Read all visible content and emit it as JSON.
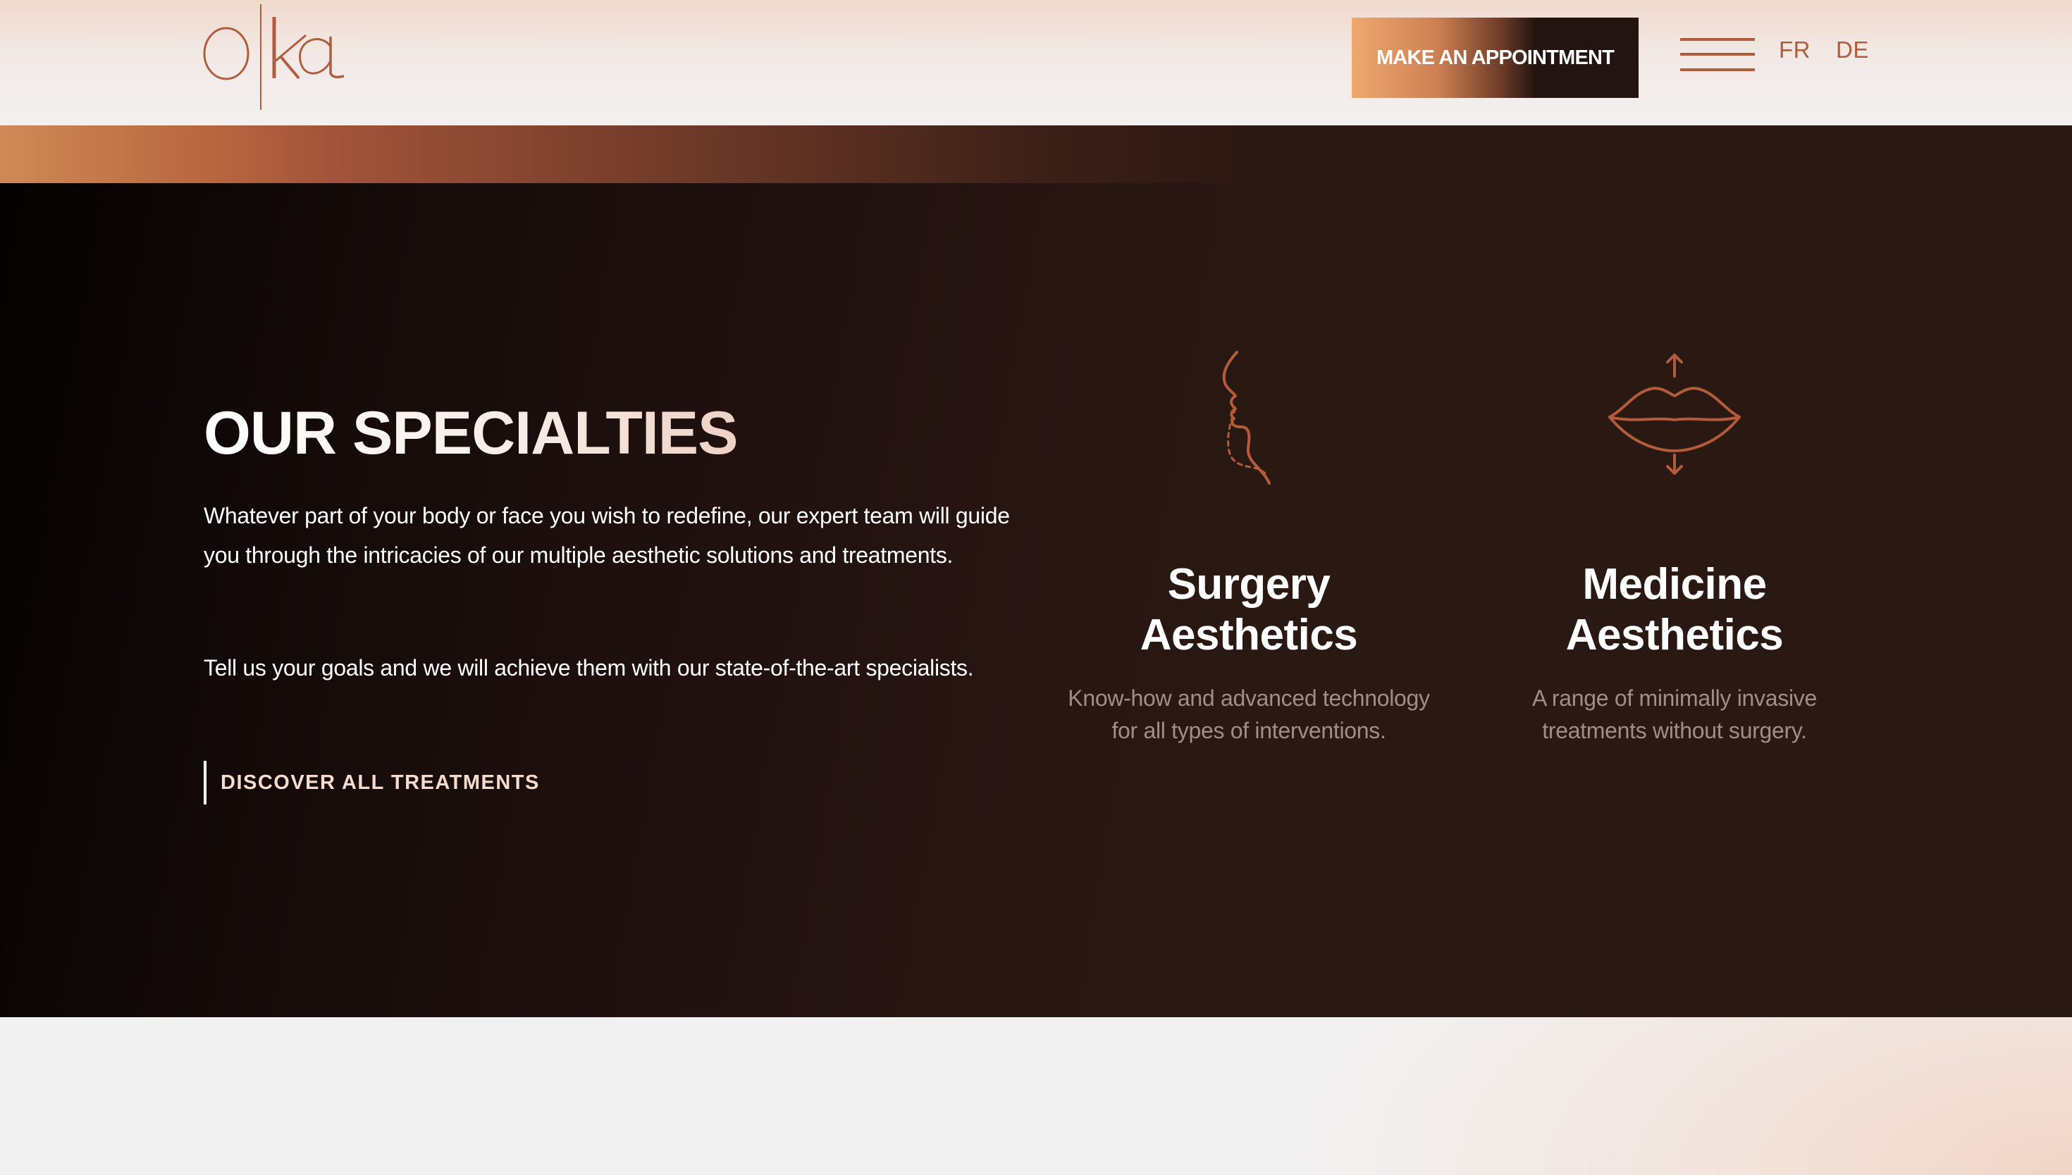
{
  "header": {
    "logo_text": "oka",
    "appointment_label": "MAKE AN APPOINTMENT",
    "menu_icon": "hamburger-menu-icon",
    "languages": [
      "FR",
      "DE"
    ]
  },
  "specialties": {
    "title": "OUR SPECIALTIES",
    "intro": "Whatever part of your body or face you wish to redefine, our expert team will guide you through the intricacies of our multiple aesthetic solutions and treatments.",
    "goals": "Tell us your goals and we will achieve them with our state-of-the-art specialists.",
    "cta_label": "DISCOVER ALL TREATMENTS",
    "cards": [
      {
        "icon": "face-profile-icon",
        "title_line1": "Surgery",
        "title_line2": "Aesthetics",
        "desc_line1": "Know-how and advanced technology",
        "desc_line2": "for all types of interventions."
      },
      {
        "icon": "lips-icon",
        "title_line1": "Medicine",
        "title_line2": "Aesthetics",
        "desc_line1": "A range of minimally invasive",
        "desc_line2": "treatments without surgery."
      }
    ]
  },
  "colors": {
    "accent": "#b05d3d",
    "dark_bg": "#2a1812",
    "light_bg": "#f2f1f1"
  }
}
